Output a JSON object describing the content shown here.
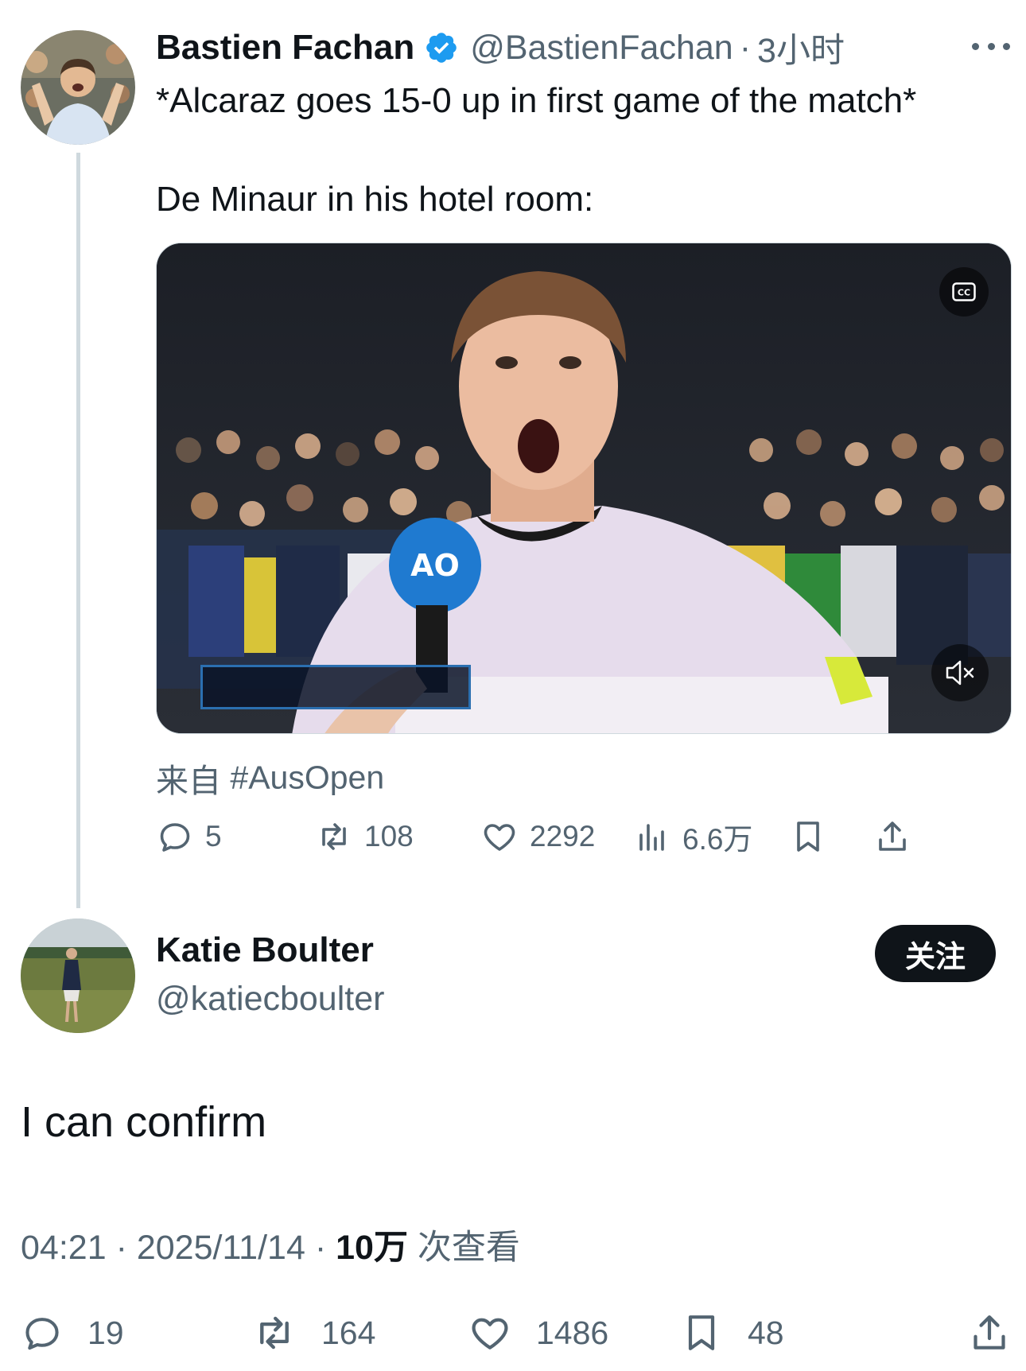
{
  "tweet": {
    "author_name": "Bastien Fachan",
    "author_handle": "@BastienFachan",
    "separator": "·",
    "time_ago": "3小时",
    "text_line_1": "*Alcaraz goes 15-0 up in first game of the match*",
    "text_line_2": "De Minaur in his hotel room:",
    "source_prefix": "来自",
    "source_tag": "#AusOpen",
    "stats": {
      "replies": "5",
      "retweets": "108",
      "likes": "2292",
      "views": "6.6万"
    }
  },
  "reply": {
    "author_name": "Katie Boulter",
    "author_handle": "@katiecboulter",
    "follow_label": "关注",
    "text": "I can confirm",
    "time": "04:21",
    "date": "2025/11/14",
    "views_num": "10万",
    "views_label": "次查看",
    "stats": {
      "replies": "19",
      "retweets": "164",
      "likes": "1486",
      "bookmarks": "48"
    }
  },
  "icons": {
    "verified": "verified-badge-icon",
    "more": "more-icon",
    "reply": "reply-icon",
    "retweet": "retweet-icon",
    "like": "heart-icon",
    "views": "views-icon",
    "bookmark": "bookmark-icon",
    "share": "share-icon",
    "cc": "cc-icon",
    "mute": "mute-icon"
  },
  "colors": {
    "text": "#0f1419",
    "secondary": "#536471",
    "verified": "#1d9bf0",
    "thread_line": "#cfd9de",
    "follow_button": "#0f1419"
  }
}
